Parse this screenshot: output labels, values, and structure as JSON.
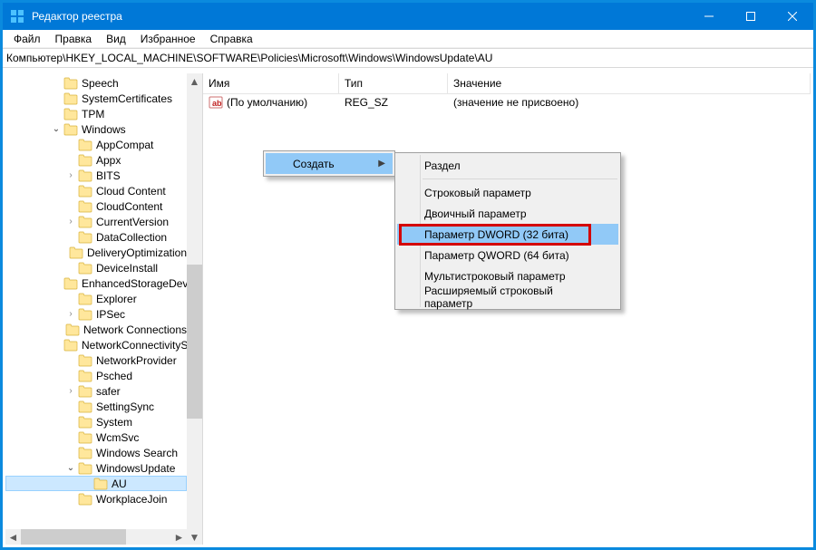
{
  "window": {
    "title": "Редактор реестра"
  },
  "menu": {
    "file": "Файл",
    "edit": "Правка",
    "view": "Вид",
    "favorites": "Избранное",
    "help": "Справка"
  },
  "address": "Компьютер\\HKEY_LOCAL_MACHINE\\SOFTWARE\\Policies\\Microsoft\\Windows\\WindowsUpdate\\AU",
  "columns": {
    "name": "Имя",
    "type": "Тип",
    "value": "Значение"
  },
  "default_row": {
    "name": "(По умолчанию)",
    "type": "REG_SZ",
    "value": "(значение не присвоено)"
  },
  "tree": [
    {
      "indent": 3,
      "twist": "",
      "label": "Speech"
    },
    {
      "indent": 3,
      "twist": "",
      "label": "SystemCertificates"
    },
    {
      "indent": 3,
      "twist": "",
      "label": "TPM"
    },
    {
      "indent": 3,
      "twist": "open",
      "label": "Windows"
    },
    {
      "indent": 4,
      "twist": "",
      "label": "AppCompat"
    },
    {
      "indent": 4,
      "twist": "",
      "label": "Appx"
    },
    {
      "indent": 4,
      "twist": "closed",
      "label": "BITS"
    },
    {
      "indent": 4,
      "twist": "",
      "label": "Cloud Content"
    },
    {
      "indent": 4,
      "twist": "",
      "label": "CloudContent"
    },
    {
      "indent": 4,
      "twist": "closed",
      "label": "CurrentVersion"
    },
    {
      "indent": 4,
      "twist": "",
      "label": "DataCollection"
    },
    {
      "indent": 4,
      "twist": "",
      "label": "DeliveryOptimization"
    },
    {
      "indent": 4,
      "twist": "",
      "label": "DeviceInstall"
    },
    {
      "indent": 4,
      "twist": "",
      "label": "EnhancedStorageDevices"
    },
    {
      "indent": 4,
      "twist": "",
      "label": "Explorer"
    },
    {
      "indent": 4,
      "twist": "closed",
      "label": "IPSec"
    },
    {
      "indent": 4,
      "twist": "",
      "label": "Network Connections"
    },
    {
      "indent": 4,
      "twist": "",
      "label": "NetworkConnectivityStatus"
    },
    {
      "indent": 4,
      "twist": "",
      "label": "NetworkProvider"
    },
    {
      "indent": 4,
      "twist": "",
      "label": "Psched"
    },
    {
      "indent": 4,
      "twist": "closed",
      "label": "safer"
    },
    {
      "indent": 4,
      "twist": "",
      "label": "SettingSync"
    },
    {
      "indent": 4,
      "twist": "",
      "label": "System"
    },
    {
      "indent": 4,
      "twist": "",
      "label": "WcmSvc"
    },
    {
      "indent": 4,
      "twist": "",
      "label": "Windows Search"
    },
    {
      "indent": 4,
      "twist": "open",
      "label": "WindowsUpdate"
    },
    {
      "indent": 5,
      "twist": "",
      "label": "AU",
      "selected": true
    },
    {
      "indent": 4,
      "twist": "",
      "label": "WorkplaceJoin"
    }
  ],
  "ctx1": {
    "create": "Создать"
  },
  "ctx2": {
    "key": "Раздел",
    "string": "Строковый параметр",
    "binary": "Двоичный параметр",
    "dword": "Параметр DWORD (32 бита)",
    "qword": "Параметр QWORD (64 бита)",
    "multi": "Мультистроковый параметр",
    "expand": "Расширяемый строковый параметр"
  }
}
